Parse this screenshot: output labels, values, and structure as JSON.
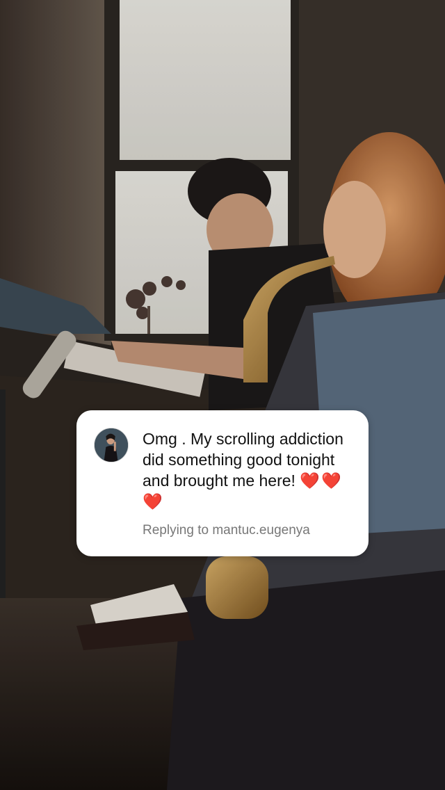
{
  "reply_card": {
    "avatar_icon": "user-avatar-icon",
    "comment": "Omg . My scrolling addiction did something good tonight and brought me here!",
    "hearts": "❤️❤️❤️",
    "reply_prefix": "Replying to",
    "reply_username": "mantuc.eugenya"
  },
  "colors": {
    "card_bg": "#ffffff",
    "text_primary": "#111111",
    "text_secondary": "#777777",
    "heart": "#e0202e"
  }
}
